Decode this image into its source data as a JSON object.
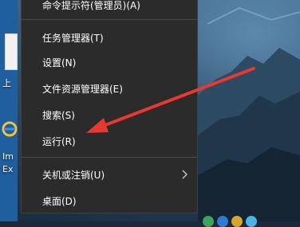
{
  "desktop": {
    "left_label_1": "上",
    "left_label_2": "Im",
    "left_label_3": "Ex"
  },
  "menu": {
    "items": [
      {
        "label": "命令提示符(管理员)(A)"
      },
      {
        "label": "任务管理器(T)"
      },
      {
        "label": "设置(N)"
      },
      {
        "label": "文件资源管理器(E)"
      },
      {
        "label": "搜索(S)"
      },
      {
        "label": "运行(R)"
      },
      {
        "label": "关机或注销(U)"
      },
      {
        "label": "桌面(D)"
      }
    ],
    "submenu_icon": "chevron-right-icon"
  },
  "annotation": {
    "arrow_color": "#e8382f",
    "arrow_icon": "arrow-pointer"
  },
  "colors": {
    "menu_bg": "#2b2b2b",
    "menu_text": "#ffffff",
    "separator": "#4b4b4b"
  }
}
